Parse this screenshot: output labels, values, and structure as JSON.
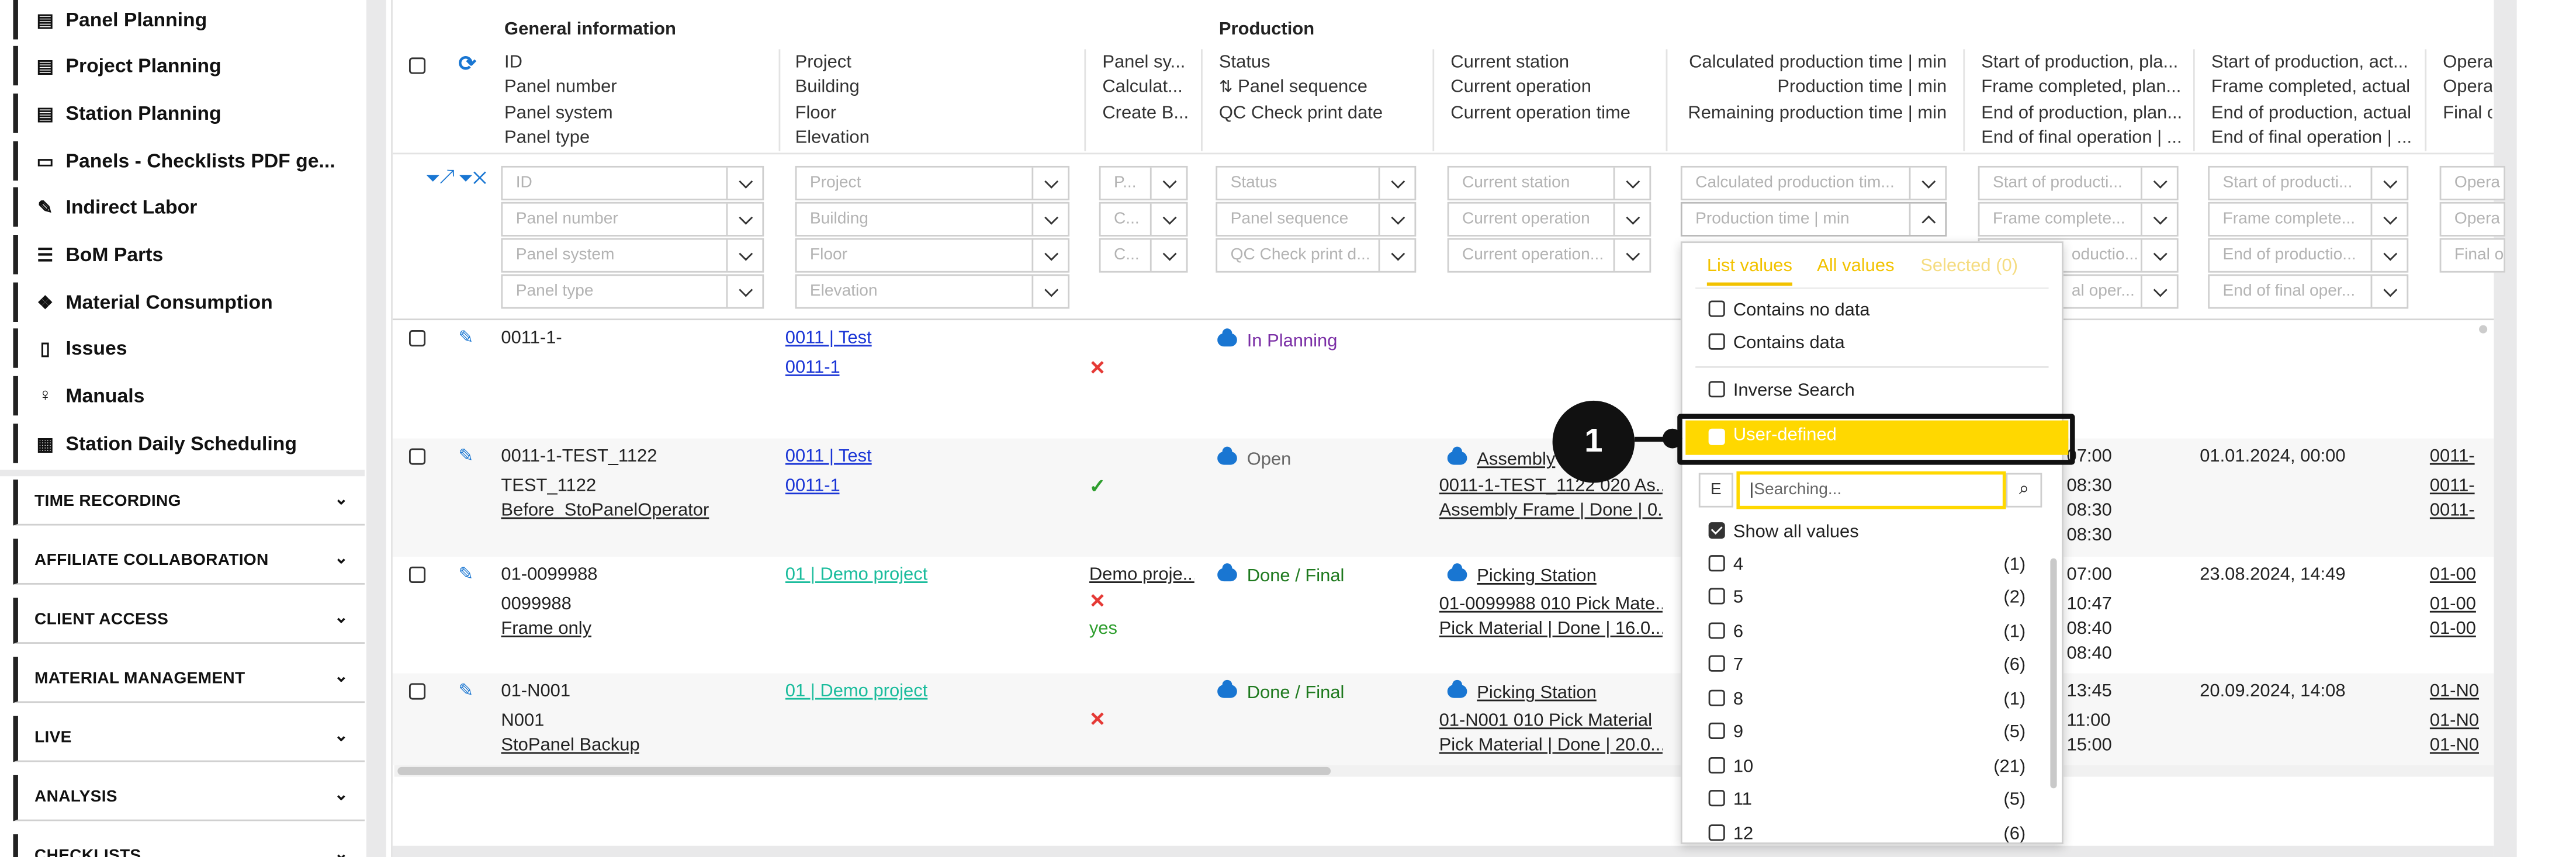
{
  "sidebar": {
    "items": [
      {
        "label": "Panel Planning",
        "icon": "gantt-icon"
      },
      {
        "label": "Project Planning",
        "icon": "gantt-icon"
      },
      {
        "label": "Station Planning",
        "icon": "gantt-icon"
      },
      {
        "label": "Panels - Checklists PDF ge...",
        "icon": "rectangle-icon"
      },
      {
        "label": "Indirect Labor",
        "icon": "brush-icon"
      },
      {
        "label": "BoM Parts",
        "icon": "list-icon"
      },
      {
        "label": "Material Consumption",
        "icon": "cubes-icon"
      },
      {
        "label": "Issues",
        "icon": "thermometer-icon"
      },
      {
        "label": "Manuals",
        "icon": "lightbulb-icon"
      },
      {
        "label": "Station Daily Scheduling",
        "icon": "calendar-icon"
      }
    ],
    "sections": [
      "TIME RECORDING",
      "AFFILIATE COLLABORATION",
      "CLIENT ACCESS",
      "MATERIAL MANAGEMENT",
      "LIVE",
      "ANALYSIS",
      "CHECKLISTS"
    ]
  },
  "header": {
    "group_general": "General information",
    "group_production": "Production",
    "col1": [
      "ID",
      "Panel number",
      "Panel system",
      "Panel type"
    ],
    "col2": [
      "Project",
      "Building",
      "Floor",
      "Elevation"
    ],
    "col3": [
      "Panel sy...",
      "Calculat...",
      "Create B..."
    ],
    "col4": [
      "Status",
      "Panel sequence",
      "QC Check print date"
    ],
    "col5": [
      "Current station",
      "Current operation",
      "Current operation time"
    ],
    "col6": [
      "Calculated production time | min",
      "Production time | min",
      "Remaining production time | min"
    ],
    "col7": [
      "Start of production, pla...",
      "Frame completed, plan...",
      "End of production, plan...",
      "End of final operation | ..."
    ],
    "col8": [
      "Start of production, act...",
      "Frame completed, actual",
      "End of production, actual",
      "End of final operation | ..."
    ],
    "col9": [
      "Opera",
      "Opera",
      "Final o"
    ]
  },
  "filters": {
    "col1": [
      "ID",
      "Panel number",
      "Panel system",
      "Panel type"
    ],
    "col2": [
      "Project",
      "Building",
      "Floor",
      "Elevation"
    ],
    "col3": [
      "P...",
      "C...",
      "C..."
    ],
    "col4": [
      "Status",
      "Panel sequence",
      "QC Check print d..."
    ],
    "col5": [
      "Current station",
      "Current operation",
      "Current operation..."
    ],
    "col6": [
      "Calculated production tim...",
      "Production time | min"
    ],
    "col7": [
      "Start of producti...",
      "Frame complete...",
      "oductio...",
      "al oper..."
    ],
    "col8": [
      "Start of producti...",
      "Frame complete...",
      "End of productio...",
      "End of final oper..."
    ],
    "col9": [
      "Opera",
      "Opera",
      "Final o"
    ]
  },
  "rows": [
    {
      "id": "0011-1-",
      "number": "",
      "system": "",
      "project": "0011 | Test",
      "building": "0011-1",
      "status": "In Planning",
      "station": "",
      "op": "",
      "optime": "",
      "planned": [],
      "actual": "",
      "ops": []
    },
    {
      "id": "0011-1-TEST_1122",
      "number": "TEST_1122",
      "system": "Before_StoPanelOperator",
      "project": "0011 | Test",
      "building": "0011-1",
      "status": "Open",
      "station": "Assembly",
      "op": "0011-1-TEST_1122 020 As...",
      "optime": "Assembly Frame | Done | 0...",
      "planned": [
        "07:00",
        "08:30",
        "08:30",
        "08:30"
      ],
      "actual": "01.01.2024, 00:00",
      "ops": [
        "0011-",
        "0011-",
        "0011-"
      ]
    },
    {
      "id": "01-0099988",
      "number": "0099988",
      "system": "Frame only",
      "project": "01 | Demo project",
      "building": "",
      "panel_system": "Demo proje...",
      "create": "yes",
      "status": "Done / Final",
      "station": "Picking Station",
      "op": "01-0099988 010 Pick Mate...",
      "optime": "Pick Material | Done | 16.0...",
      "planned": [
        "07:00",
        "10:47",
        "08:40",
        "08:40"
      ],
      "actual": "23.08.2024, 14:49",
      "ops": [
        "01-00",
        "01-00",
        "01-00"
      ]
    },
    {
      "id": "01-N001",
      "number": "N001",
      "system": "StoPanel Backup",
      "project": "01 | Demo project",
      "building": "",
      "status": "Done / Final",
      "station": "Picking Station",
      "op": "01-N001 010 Pick Material",
      "optime": "Pick Material | Done | 20.0...",
      "planned": [
        "13:45",
        "11:00",
        "15:00"
      ],
      "actual": "20.09.2024, 14:08",
      "ops": [
        "01-N0",
        "01-N0",
        "01-N0"
      ]
    }
  ],
  "dropdown": {
    "tabs": [
      "List values",
      "All values",
      "Selected (0)"
    ],
    "options": [
      "Contains no data",
      "Contains data",
      "Inverse Search",
      "User-defined"
    ],
    "operator": "E",
    "search_placeholder": "Searching...",
    "show_all": "Show all values",
    "values": [
      {
        "v": "4",
        "c": "(1)"
      },
      {
        "v": "5",
        "c": "(2)"
      },
      {
        "v": "6",
        "c": "(1)"
      },
      {
        "v": "7",
        "c": "(6)"
      },
      {
        "v": "8",
        "c": "(1)"
      },
      {
        "v": "9",
        "c": "(5)"
      },
      {
        "v": "10",
        "c": "(21)"
      },
      {
        "v": "11",
        "c": "(5)"
      },
      {
        "v": "12",
        "c": "(6)"
      }
    ]
  },
  "callout": "1",
  "colors": {
    "accent": "#ffd800",
    "link": "#1a35d6",
    "status_cloud": "#1976d2"
  }
}
